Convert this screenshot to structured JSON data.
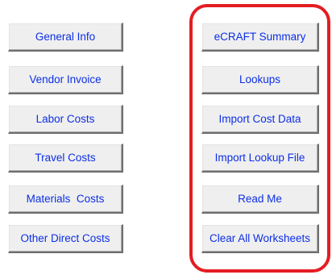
{
  "left_buttons": [
    {
      "label": "General Info"
    },
    {
      "label": "Vendor Invoice"
    },
    {
      "label": "Labor Costs"
    },
    {
      "label": "Travel Costs"
    },
    {
      "label": "Materials  Costs"
    },
    {
      "label": "Other Direct Costs"
    }
  ],
  "right_buttons": [
    {
      "label": "eCRAFT Summary"
    },
    {
      "label": "Lookups"
    },
    {
      "label": "Import Cost Data"
    },
    {
      "label": "Import Lookup File"
    },
    {
      "label": "Read Me"
    },
    {
      "label": "Clear All Worksheets"
    }
  ],
  "colors": {
    "button_text": "#0c2fe6",
    "button_face": "#efefef",
    "highlight_border": "#e41d22"
  }
}
